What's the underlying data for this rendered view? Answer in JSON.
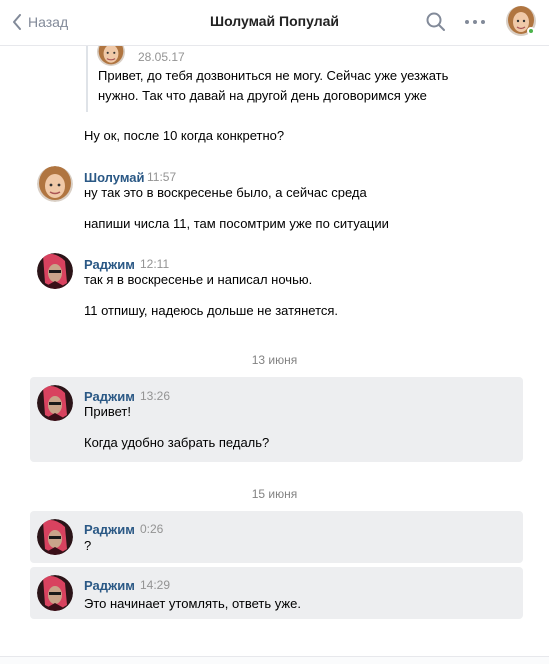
{
  "header": {
    "back_label": "Назад",
    "title": "Шолумай Популай",
    "online_color": "#4bb34b"
  },
  "quote": {
    "date": "28.05.17",
    "text": "Привет, до тебя дозвониться не могу. Сейчас уже уезжать нужно. Так что давай на другой день договоримся уже"
  },
  "messages": [
    {
      "text": "Ну ок, после 10 когда конкретно?"
    },
    {
      "author": "Шолумай",
      "time": "11:57",
      "lines": [
        "ну так это в воскресенье было, а сейчас среда",
        "напиши числа 11, там посомтрим уже по ситуации"
      ]
    },
    {
      "author": "Раджим",
      "time": "12:11",
      "lines": [
        "так я в воскресенье и написал ночью.",
        "11 отпишу, надеюсь дольше не затянется."
      ]
    },
    {
      "date_separator": "13 июня"
    },
    {
      "author": "Раджим",
      "time": "13:26",
      "lines": [
        "Привет!",
        "Когда удобно забрать педаль?"
      ]
    },
    {
      "date_separator": "15 июня"
    },
    {
      "author": "Раджим",
      "time": "0:26",
      "lines": [
        "?"
      ]
    },
    {
      "author": "Раджим",
      "time": "14:29",
      "lines": [
        "Это начинает утомлять, ответь уже."
      ]
    }
  ],
  "icons": {
    "back": "chevron-left-icon",
    "search": "search-icon",
    "more": "more-horizontal-icon"
  }
}
